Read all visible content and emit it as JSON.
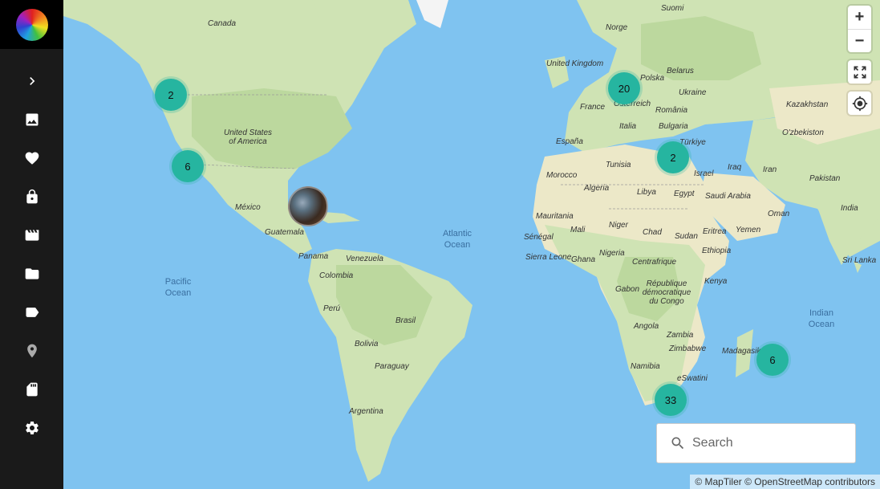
{
  "sidebar": {
    "logo": "rainbow-circle-logo",
    "items": [
      {
        "name": "expand-icon"
      },
      {
        "name": "photos-icon"
      },
      {
        "name": "favorites-icon"
      },
      {
        "name": "private-icon"
      },
      {
        "name": "videos-icon"
      },
      {
        "name": "folders-icon"
      },
      {
        "name": "labels-icon"
      },
      {
        "name": "places-icon"
      },
      {
        "name": "library-icon"
      },
      {
        "name": "settings-icon"
      }
    ]
  },
  "map": {
    "labels": {
      "canada": "Canada",
      "united_states": "United States of America",
      "mexico": "México",
      "guatemala": "Guatemala",
      "panama": "Panama",
      "venezuela": "Venezuela",
      "colombia": "Colombia",
      "peru": "Perú",
      "brasil": "Brasil",
      "bolivia": "Bolivia",
      "paraguay": "Paraguay",
      "argentina": "Argentina",
      "suomi": "Suomi",
      "norge": "Norge",
      "united_kingdom": "United Kingdom",
      "polska": "Polska",
      "belarus": "Belarus",
      "ukraine": "Ukraine",
      "osterreich": "Österreich",
      "france": "France",
      "romania": "România",
      "italia": "Italia",
      "bulgaria": "Bulgaria",
      "espana": "España",
      "turkiye": "Türkiye",
      "kazakhstan": "Kazakhstan",
      "ozbekiston": "O'zbekiston",
      "tunisia": "Tunisia",
      "israel": "Israel",
      "iraq": "Iraq",
      "iran": "Iran",
      "pakistan": "Pakistan",
      "morocco": "Morocco",
      "algeria": "Algeria",
      "libya": "Libya",
      "egypt": "Egypt",
      "saudi_arabia": "Saudi Arabia",
      "oman": "Oman",
      "india": "India",
      "mauritania": "Mauritania",
      "mali": "Mali",
      "niger": "Niger",
      "chad": "Chad",
      "sudan": "Sudan",
      "eritrea": "Eritrea",
      "yemen": "Yemen",
      "senegal": "Sénégal",
      "sierra_leone": "Sierra Leone",
      "ghana": "Ghana",
      "nigeria": "Nigeria",
      "centrafrique": "Centrafrique",
      "ethiopia": "Ethiopia",
      "sri_lanka": "Sri Lanka",
      "gabon": "Gabon",
      "rdc": "République démocratique du Congo",
      "kenya": "Kenya",
      "angola": "Angola",
      "zambia": "Zambia",
      "zimbabwe": "Zimbabwe",
      "madagasikara": "Madagasikara",
      "namibia": "Namibia",
      "eswatini": "eSwatini"
    },
    "oceans": {
      "pacific": "Pacific Ocean",
      "atlantic": "Atlantic Ocean",
      "indian": "Indian Ocean"
    },
    "clusters": [
      {
        "id": "west-canada",
        "count": "2"
      },
      {
        "id": "california",
        "count": "6"
      },
      {
        "id": "europe",
        "count": "20"
      },
      {
        "id": "east-med",
        "count": "2"
      },
      {
        "id": "south-africa",
        "count": "33"
      },
      {
        "id": "mauritius",
        "count": "6"
      }
    ]
  },
  "controls": {
    "zoom_in": "+",
    "zoom_out": "−"
  },
  "search": {
    "placeholder": "Search"
  },
  "attribution": "© MapTiler © OpenStreetMap contributors",
  "colors": {
    "cluster": "#26b5a0",
    "ocean": "#7fc3f0",
    "land": "#cfe3b4",
    "sidebar": "#1a1a1a"
  }
}
